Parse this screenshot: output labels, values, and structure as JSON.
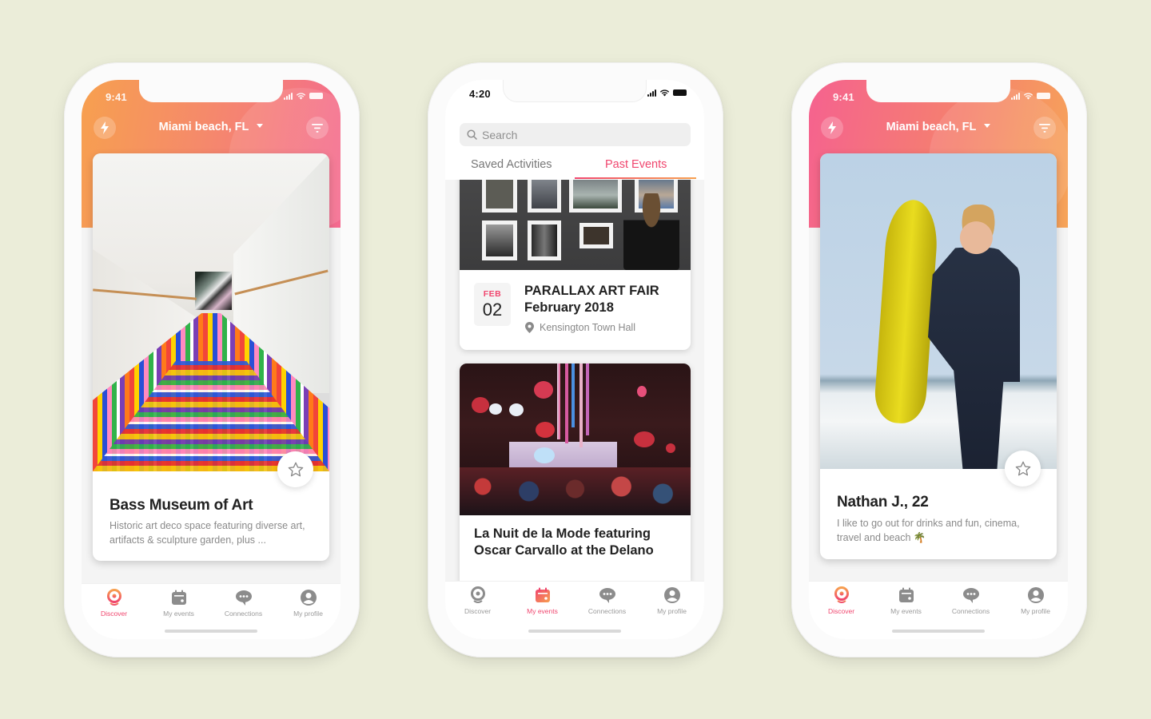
{
  "background_color": "#ebedd9",
  "accent_pink": "#f0466e",
  "accent_orange": "#f7a04f",
  "phones": [
    {
      "status_bar": {
        "time": "9:41"
      },
      "header": {
        "location": "Miami beach, FL",
        "left_icon": "lightning-icon",
        "right_icon": "filter-icon"
      },
      "card": {
        "photo": "museum-rainbow-floor-photo",
        "title": "Bass Museum of Art",
        "description": "Historic art deco space featuring diverse art, artifacts & sculpture garden, plus ...",
        "favorite_icon": "star-outline-icon"
      },
      "tabbar": {
        "active": "Discover",
        "items": [
          {
            "label": "Discover",
            "icon": "discover-pin-icon"
          },
          {
            "label": "My events",
            "icon": "calendar-icon"
          },
          {
            "label": "Connections",
            "icon": "chat-bubble-icon"
          },
          {
            "label": "My profile",
            "icon": "profile-icon"
          }
        ]
      }
    },
    {
      "status_bar": {
        "time": "4:20"
      },
      "search": {
        "placeholder": "Search"
      },
      "tabs": [
        {
          "label": "Saved Activities",
          "active": false
        },
        {
          "label": "Past Events",
          "active": true
        }
      ],
      "events": [
        {
          "photo": "gallery-wall-photo",
          "month": "FEB",
          "day": "02",
          "title": "PARALLAX ART FAIR February 2018",
          "location": "Kensington Town Hall"
        },
        {
          "photo": "party-concert-photo",
          "title": "La Nuit de la Mode featuring Oscar Carvallo at the Delano"
        }
      ],
      "tabbar": {
        "active": "My events",
        "items": [
          {
            "label": "Discover",
            "icon": "discover-pin-icon"
          },
          {
            "label": "My events",
            "icon": "calendar-icon"
          },
          {
            "label": "Connections",
            "icon": "chat-bubble-icon"
          },
          {
            "label": "My profile",
            "icon": "profile-icon"
          }
        ]
      }
    },
    {
      "status_bar": {
        "time": "9:41"
      },
      "header": {
        "location": "Miami beach, FL",
        "left_icon": "lightning-icon",
        "right_icon": "filter-icon"
      },
      "card": {
        "photo": "surfer-photo",
        "title": "Nathan J., 22",
        "description": "I like to go out for drinks and fun, cinema, travel and beach 🌴",
        "favorite_icon": "star-outline-icon"
      },
      "tabbar": {
        "active": "Discover",
        "items": [
          {
            "label": "Discover",
            "icon": "discover-pin-icon"
          },
          {
            "label": "My events",
            "icon": "calendar-icon"
          },
          {
            "label": "Connections",
            "icon": "chat-bubble-icon"
          },
          {
            "label": "My profile",
            "icon": "profile-icon"
          }
        ]
      }
    }
  ]
}
